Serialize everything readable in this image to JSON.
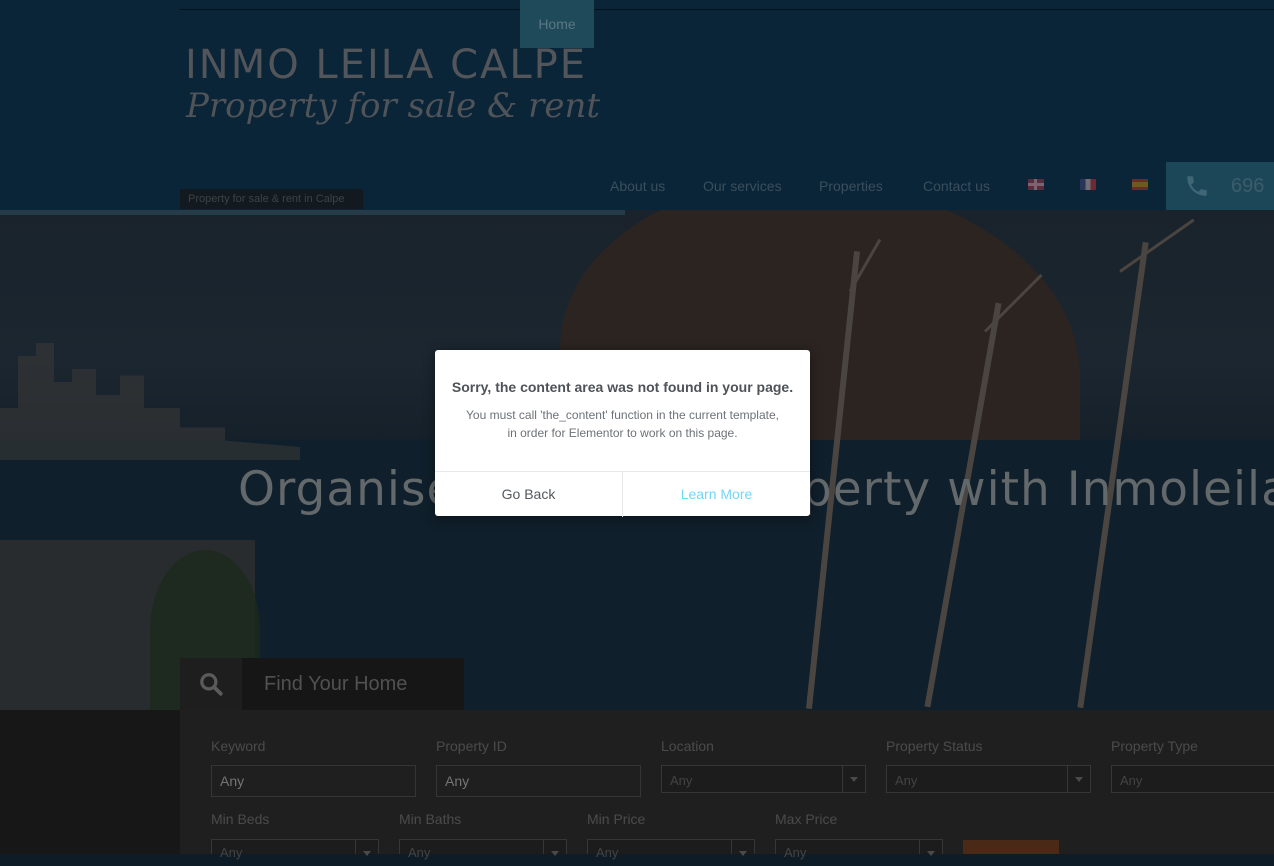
{
  "header": {
    "logo_main": "INMO LEILA CALPE",
    "logo_sub": "Property for sale & rent",
    "tagline": "Property for sale & rent in Calpe",
    "nav": [
      "Home",
      "About us",
      "Our services",
      "Properties",
      "Contact us"
    ],
    "phone_partial": "696"
  },
  "hero": {
    "title": "Organise your next property with Inmoleilacalpe",
    "find_tab_label": "Find Your Home"
  },
  "search_form": {
    "keyword_label": "Keyword",
    "keyword_placeholder": "Any",
    "property_id_label": "Property ID",
    "property_id_placeholder": "Any",
    "location_label": "Location",
    "location_value": "Any",
    "status_label": "Property Status",
    "status_value": "Any",
    "type_label": "Property Type",
    "type_value": "Any",
    "min_beds_label": "Min Beds",
    "min_beds_value": "Any",
    "min_baths_label": "Min Baths",
    "min_baths_value": "Any",
    "min_price_label": "Min Price",
    "min_price_value": "Any",
    "max_price_label": "Max Price",
    "max_price_value": "Any"
  },
  "modal": {
    "title": "Sorry, the content area was not found in your page.",
    "message_line1": "You must call 'the_content' function in the current template,",
    "message_line2": "in order for Elementor to work on this page.",
    "go_back": "Go Back",
    "learn_more": "Learn More",
    "learn_more_color": "#71d7f7"
  },
  "icons": {
    "phone": "phone-icon",
    "search": "search-icon",
    "flags": [
      "flag-uk-icon",
      "flag-fr-icon",
      "flag-es-icon"
    ]
  }
}
